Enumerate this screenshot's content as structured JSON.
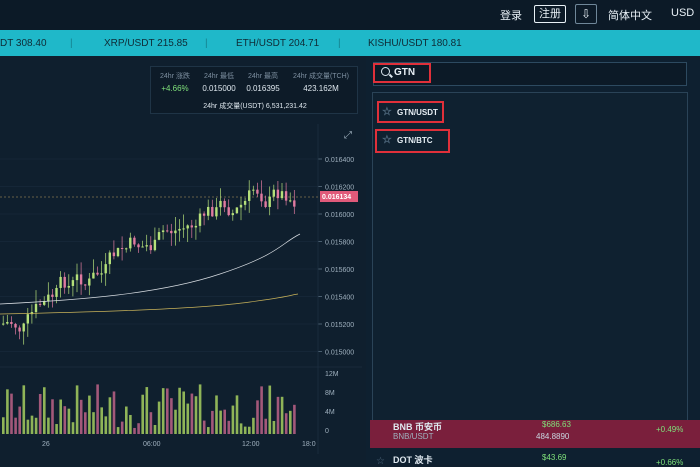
{
  "header": {
    "login": "登录",
    "register": "注册",
    "download_icon": "download-icon",
    "language": "简体中文",
    "currency": "USD"
  },
  "ticker": [
    "DT 308.40",
    "XRP/USDT 215.85",
    "ETH/USDT 204.71",
    "KISHU/USDT 180.81"
  ],
  "stats": {
    "change_label": "24hr 涨跌",
    "change_value": "+4.66%",
    "low_label": "24hr 最低",
    "low_value": "0.015000",
    "high_label": "24hr 最高",
    "high_value": "0.016395",
    "volume_label": "24hr 成交量(TCH)",
    "volume_value": "423.162M",
    "turnover": "24hr 成交量(USDT) 6,531,231.42"
  },
  "chart": {
    "price_ticks": [
      "0.016400",
      "0.016200",
      "0.016000",
      "0.015800",
      "0.015600",
      "0.015400",
      "0.015200",
      "0.015000"
    ],
    "current_price": "0.016134",
    "volume_ticks": [
      "12M",
      "8M",
      "4M",
      "0"
    ],
    "time_ticks": [
      "26",
      "06:00",
      "12:00",
      "18:0"
    ],
    "colors": {
      "up": "#b5e07a",
      "down": "#e07aa0",
      "current_tag": "#e05a7a"
    }
  },
  "search": {
    "value": "GTN",
    "results": [
      "GTN/USDT",
      "GTN/BTC"
    ]
  },
  "market_rows": [
    {
      "symbol": "BNB 币安币",
      "pair": "BNB/USDT",
      "price": "$686.63",
      "price_alt": "484.8890",
      "change": "+0.49%"
    },
    {
      "symbol": "DOT 波卡",
      "pair": "DOT/USDT",
      "price": "$43.69",
      "price_alt": "",
      "change": "+0.66%"
    }
  ]
}
